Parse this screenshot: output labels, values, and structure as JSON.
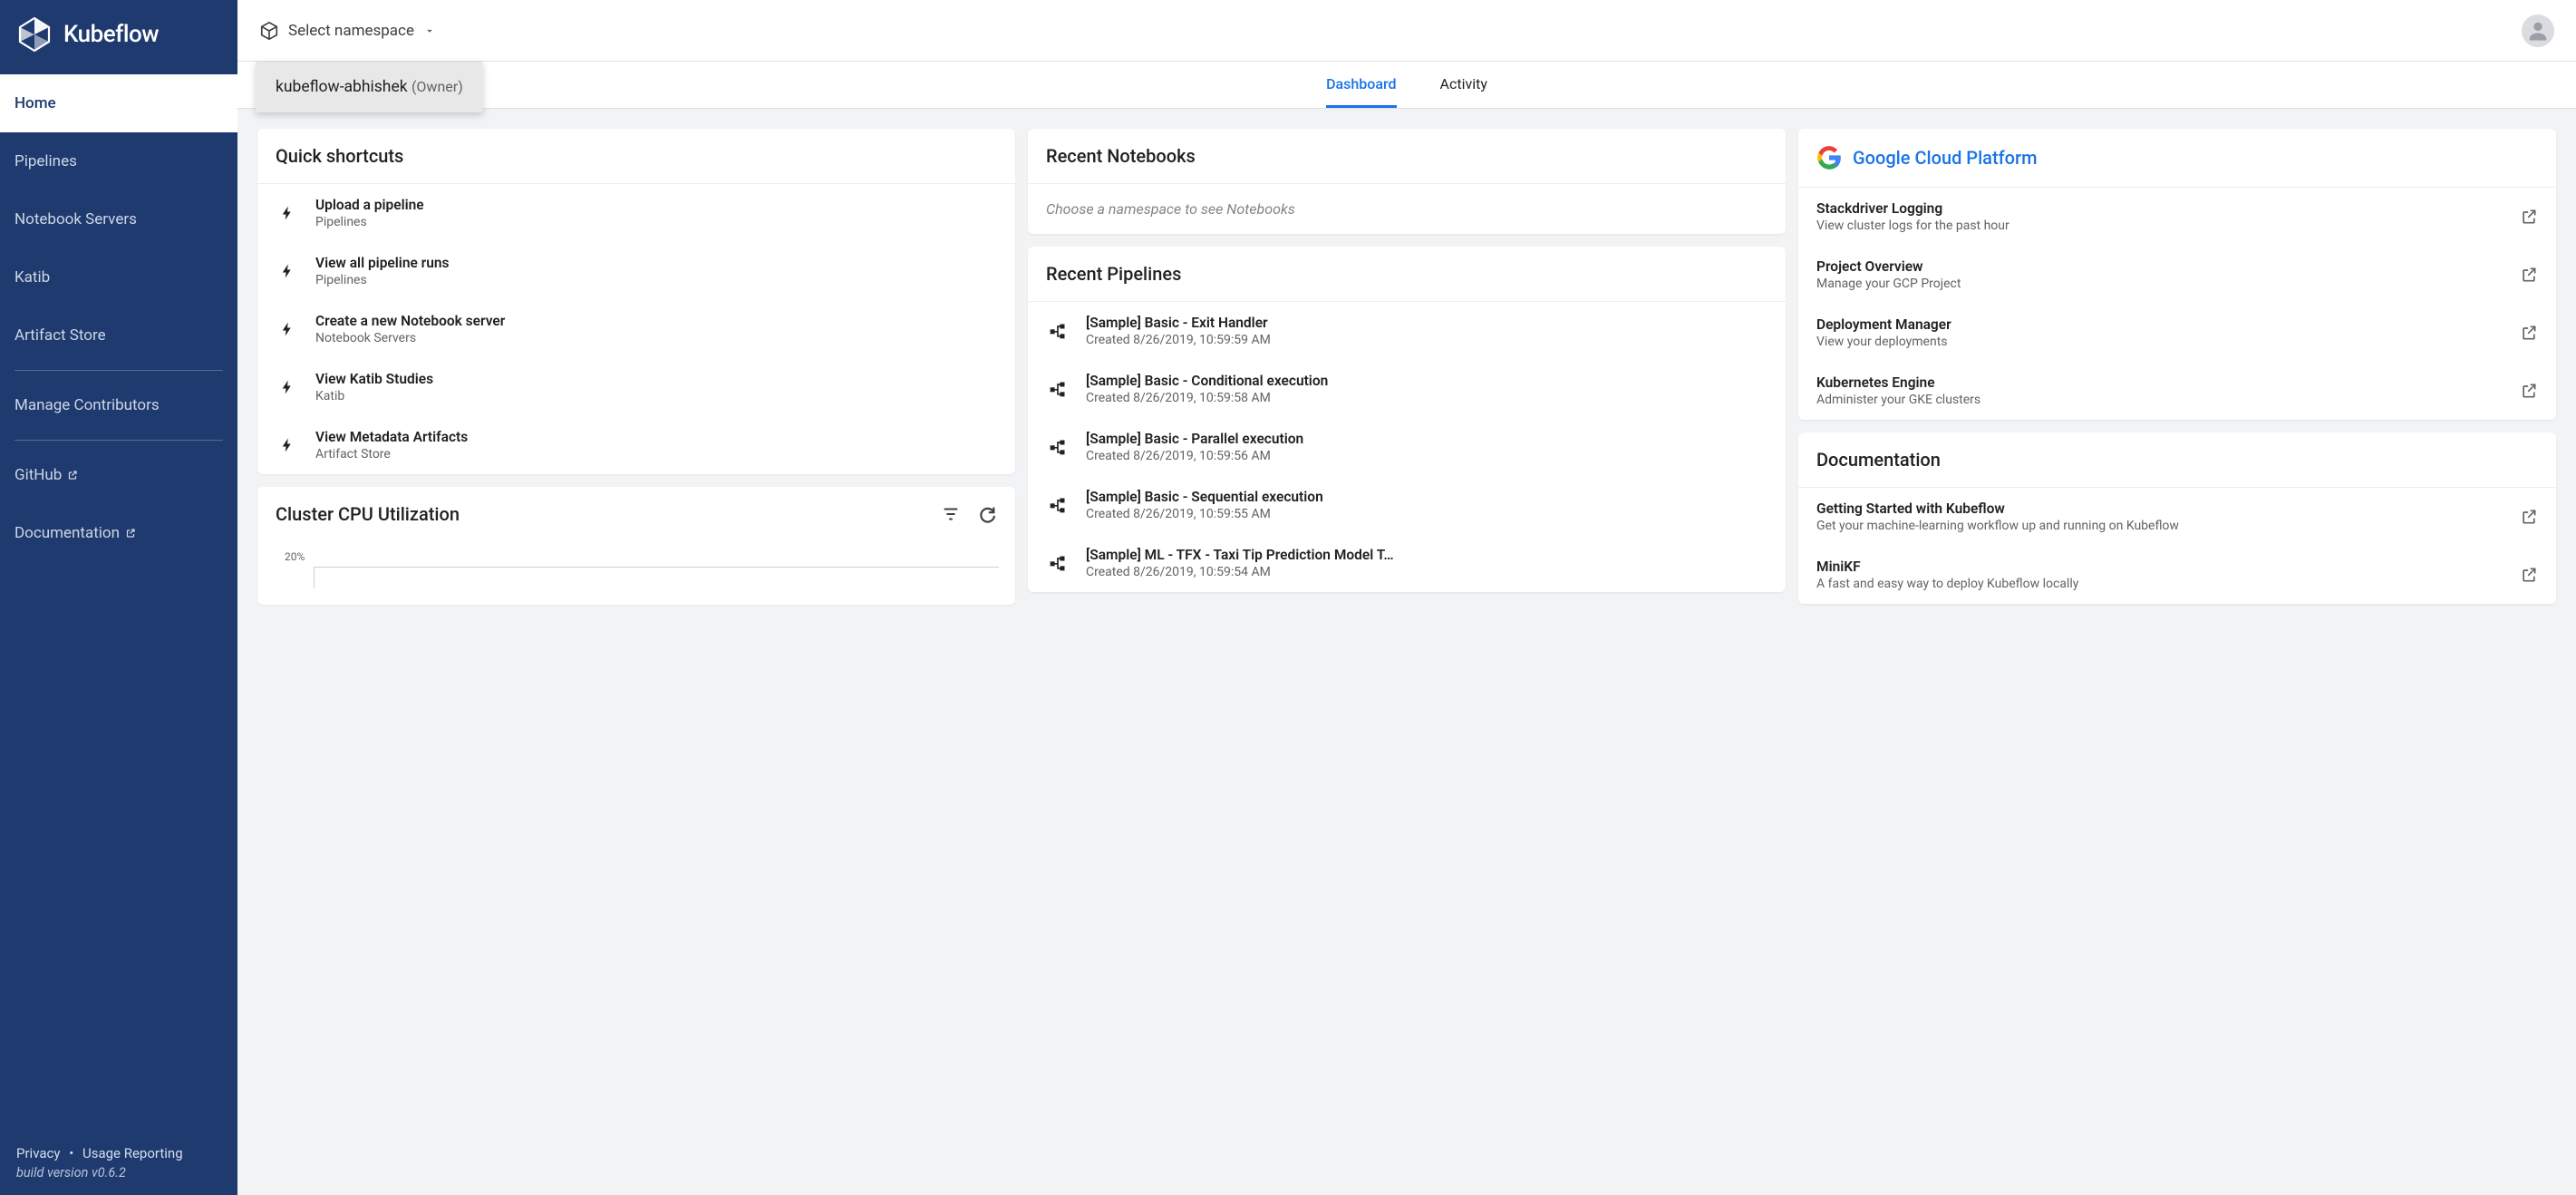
{
  "brand": "Kubeflow",
  "sidebar": {
    "items": [
      {
        "label": "Home",
        "active": true
      },
      {
        "label": "Pipelines"
      },
      {
        "label": "Notebook Servers"
      },
      {
        "label": "Katib"
      },
      {
        "label": "Artifact Store"
      }
    ],
    "secondary": [
      {
        "label": "Manage Contributors"
      }
    ],
    "external": [
      {
        "label": "GitHub"
      },
      {
        "label": "Documentation"
      }
    ]
  },
  "footer": {
    "privacy": "Privacy",
    "usage": "Usage Reporting",
    "version": "build version v0.6.2"
  },
  "topbar": {
    "namespace_label": "Select namespace"
  },
  "namespace_dropdown": {
    "name": "kubeflow-abhishek",
    "role": "(Owner)"
  },
  "tabs": {
    "dashboard": "Dashboard",
    "activity": "Activity"
  },
  "quick_shortcuts": {
    "title": "Quick shortcuts",
    "items": [
      {
        "title": "Upload a pipeline",
        "sub": "Pipelines"
      },
      {
        "title": "View all pipeline runs",
        "sub": "Pipelines"
      },
      {
        "title": "Create a new Notebook server",
        "sub": "Notebook Servers"
      },
      {
        "title": "View Katib Studies",
        "sub": "Katib"
      },
      {
        "title": "View Metadata Artifacts",
        "sub": "Artifact Store"
      }
    ]
  },
  "cpu_card": {
    "title": "Cluster CPU Utilization"
  },
  "recent_notebooks": {
    "title": "Recent Notebooks",
    "empty_msg": "Choose a namespace to see Notebooks"
  },
  "recent_pipelines": {
    "title": "Recent Pipelines",
    "items": [
      {
        "title": "[Sample] Basic - Exit Handler",
        "sub": "Created 8/26/2019, 10:59:59 AM"
      },
      {
        "title": "[Sample] Basic - Conditional execution",
        "sub": "Created 8/26/2019, 10:59:58 AM"
      },
      {
        "title": "[Sample] Basic - Parallel execution",
        "sub": "Created 8/26/2019, 10:59:56 AM"
      },
      {
        "title": "[Sample] Basic - Sequential execution",
        "sub": "Created 8/26/2019, 10:59:55 AM"
      },
      {
        "title": "[Sample] ML - TFX - Taxi Tip Prediction Model T…",
        "sub": "Created 8/26/2019, 10:59:54 AM"
      }
    ]
  },
  "gcp": {
    "title": "Google Cloud Platform",
    "items": [
      {
        "title": "Stackdriver Logging",
        "sub": "View cluster logs for the past hour"
      },
      {
        "title": "Project Overview",
        "sub": "Manage your GCP Project"
      },
      {
        "title": "Deployment Manager",
        "sub": "View your deployments"
      },
      {
        "title": "Kubernetes Engine",
        "sub": "Administer your GKE clusters"
      }
    ]
  },
  "docs": {
    "title": "Documentation",
    "items": [
      {
        "title": "Getting Started with Kubeflow",
        "sub": "Get your machine-learning workflow up and running on Kubeflow"
      },
      {
        "title": "MiniKF",
        "sub": "A fast and easy way to deploy Kubeflow locally"
      }
    ]
  },
  "chart_data": {
    "type": "line",
    "title": "Cluster CPU Utilization",
    "ylabel": "",
    "ylim": [
      0,
      100
    ],
    "ticks_visible": [
      "20%"
    ],
    "series": []
  }
}
